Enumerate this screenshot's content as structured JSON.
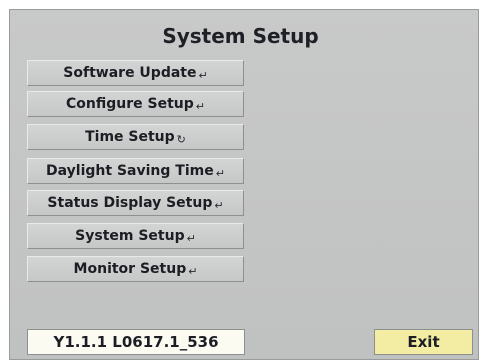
{
  "screen": {
    "title": "System Setup"
  },
  "menu": {
    "items": [
      {
        "label": "Software Update",
        "icon": "enter-icon",
        "icon_glyph": "↵"
      },
      {
        "label": "Configure Setup",
        "icon": "enter-icon",
        "icon_glyph": "↵"
      },
      {
        "label": "Time Setup",
        "icon": "enter-icon",
        "icon_glyph": "↻"
      },
      {
        "label": "Daylight Saving Time",
        "icon": "enter-icon",
        "icon_glyph": "↵"
      },
      {
        "label": "Status Display Setup",
        "icon": "enter-icon",
        "icon_glyph": "↵"
      },
      {
        "label": "System Setup",
        "icon": "enter-icon",
        "icon_glyph": "↵"
      },
      {
        "label": "Monitor Setup",
        "icon": "enter-icon",
        "icon_glyph": "↵"
      }
    ]
  },
  "footer": {
    "version": "Y1.1.1 L0617.1_536",
    "exit_label": "Exit"
  },
  "colors": {
    "panel": "#c4c5c5",
    "exit_button": "#f2eda2",
    "version_box": "#fbfbf2",
    "text": "#1d1d24"
  }
}
